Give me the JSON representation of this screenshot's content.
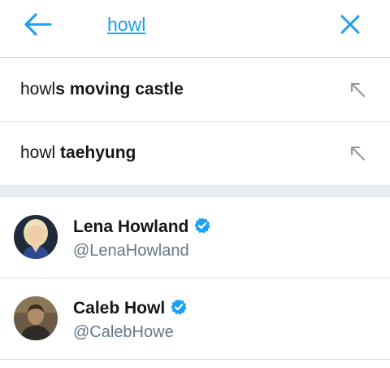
{
  "search": {
    "query": "howl",
    "back_icon": "arrow-left-icon",
    "clear_icon": "close-icon",
    "accent_color": "#1da1f2"
  },
  "suggestions": [
    {
      "prefix": "howl",
      "completion": "s moving castle",
      "icon": "arrow-up-left-icon"
    },
    {
      "prefix": "howl ",
      "completion": "taehyung",
      "icon": "arrow-up-left-icon"
    }
  ],
  "users": [
    {
      "name": "Lena Howland",
      "handle": "@LenaHowland",
      "verified": true,
      "avatar": "avatar-photo"
    },
    {
      "name": "Caleb Howl",
      "handle": "@CalebHowe",
      "verified": true,
      "avatar": "avatar-photo"
    }
  ],
  "colors": {
    "primary_text": "#14171a",
    "secondary_text": "#657786",
    "divider": "#dedede",
    "section_bg": "#e6ecf0"
  }
}
